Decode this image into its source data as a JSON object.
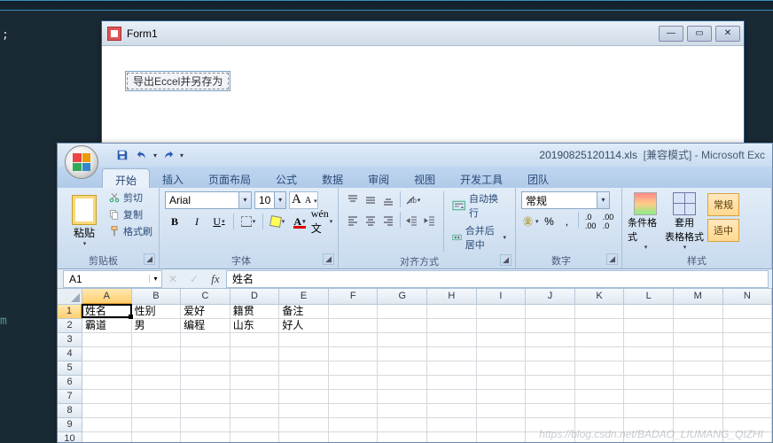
{
  "form1": {
    "title": "Form1",
    "export_button": "导出Eccel并另存为"
  },
  "excel": {
    "title_file": "20190825120114.xls",
    "title_mode": "[兼容模式]",
    "title_app": "Microsoft Exc",
    "tabs": [
      "开始",
      "插入",
      "页面布局",
      "公式",
      "数据",
      "审阅",
      "视图",
      "开发工具",
      "团队"
    ],
    "active_tab": 0,
    "clipboard": {
      "paste": "粘贴",
      "cut": "剪切",
      "copy": "复制",
      "format_painter": "格式刷",
      "group": "剪贴板"
    },
    "font": {
      "name": "Arial",
      "size": "10",
      "group": "字体"
    },
    "alignment": {
      "wrap": "自动换行",
      "merge": "合并后居中",
      "group": "对齐方式"
    },
    "number": {
      "format": "常规",
      "group": "数字"
    },
    "styles": {
      "cond_fmt": "条件格式",
      "fmt_table": "套用\n表格格式",
      "tag1": "常规",
      "tag2": "适中",
      "group": "样式"
    },
    "name_box": "A1",
    "formula": "姓名",
    "columns": [
      "A",
      "B",
      "C",
      "D",
      "E",
      "F",
      "G",
      "H",
      "I",
      "J",
      "K",
      "L",
      "M",
      "N"
    ],
    "rows": [
      "1",
      "2",
      "3",
      "4",
      "5",
      "6",
      "7",
      "8",
      "9",
      "10"
    ],
    "data": [
      [
        "姓名",
        "性别",
        "爱好",
        "籍贯",
        "备注",
        "",
        "",
        "",
        "",
        "",
        "",
        "",
        "",
        ""
      ],
      [
        "霸道",
        "男",
        "编程",
        "山东",
        "好人",
        "",
        "",
        "",
        "",
        "",
        "",
        "",
        "",
        ""
      ]
    ],
    "active_cell": {
      "row": 0,
      "col": 0
    }
  },
  "watermark": "https://blog.csdn.net/BADAO_LIUMANG_QIZHI"
}
